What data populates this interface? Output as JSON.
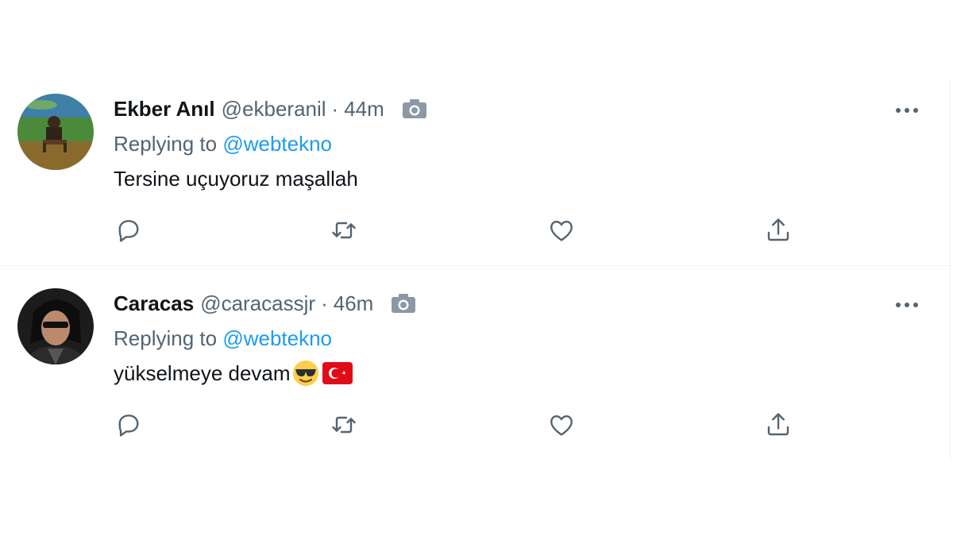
{
  "colors": {
    "text_primary": "#0f1419",
    "text_secondary": "#536471",
    "link": "#1d9bf0",
    "divider": "#eff3f4"
  },
  "tweets": [
    {
      "display_name": "Ekber Anıl",
      "handle": "@ekberanil",
      "separator": "·",
      "time": "44m",
      "media_indicator_icon": "camera-icon",
      "replying_prefix": "Replying to ",
      "replying_to": "@webtekno",
      "text": "Tersine uçuyoruz maşallah",
      "emojis": [],
      "actions": [
        "reply-icon",
        "retweet-icon",
        "like-icon",
        "share-icon"
      ]
    },
    {
      "display_name": "Caracas",
      "handle": "@caracassjr",
      "separator": "·",
      "time": "46m",
      "media_indicator_icon": "camera-icon",
      "replying_prefix": "Replying to ",
      "replying_to": "@webtekno",
      "text": "yükselmeye devam",
      "emojis": [
        "sunglasses-face-emoji",
        "turkey-flag-emoji"
      ],
      "actions": [
        "reply-icon",
        "retweet-icon",
        "like-icon",
        "share-icon"
      ]
    }
  ]
}
